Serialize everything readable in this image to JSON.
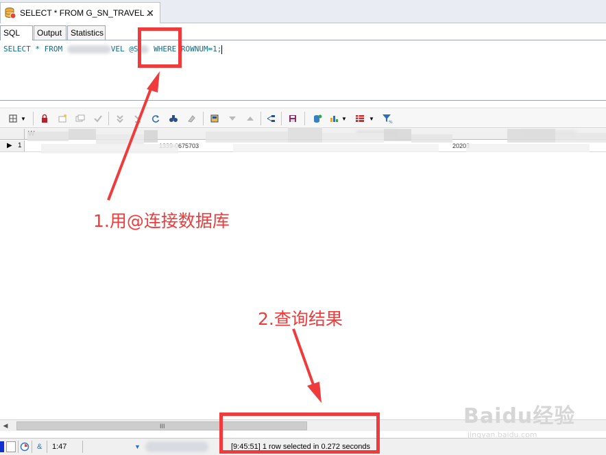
{
  "window": {
    "tab_title": "SELECT * FROM G_SN_TRAVEL ...",
    "close_glyph": "✕"
  },
  "subtabs": [
    {
      "label": "SQL",
      "active": true
    },
    {
      "label": "Output",
      "active": false
    },
    {
      "label": "Statistics",
      "active": false
    }
  ],
  "editor": {
    "sql_part1": "SELECT * FROM ",
    "sql_part2": "VEL",
    "sql_part3": "@S",
    "sql_part4": " WHERE ROWNUM=1;"
  },
  "toolbar": {
    "icons": [
      "grid-options-icon",
      "dropdown-icon",
      "lock-icon",
      "insert-record-icon",
      "copy-record-icon",
      "post-edit-icon",
      "first-record-icon",
      "last-record-icon",
      "refresh-icon",
      "find-icon",
      "clear-icon",
      "save-layout-icon",
      "sort-desc-icon",
      "sort-asc-icon",
      "export-tree-icon",
      "save-icon",
      "query-db-icon",
      "chart-icon",
      "dropdown-icon",
      "table-icon",
      "dropdown-icon",
      "filter-icon"
    ]
  },
  "grid": {
    "column_header": "W",
    "row_number": "1",
    "row_marker": "▶",
    "visible_value": "1339-0675703",
    "visible_value2": "20203"
  },
  "scrollbar": {
    "left_arrow": "◀",
    "grip": "III"
  },
  "status": {
    "position": "1:47",
    "amp": "&",
    "message": "[9:45:51]  1 row selected in 0.272 seconds"
  },
  "annotations": {
    "label1": "1.用@连接数据库",
    "label2": "2.查询结果"
  },
  "watermark": {
    "logo": "Baidu经验",
    "url": "jingyan.baidu.com"
  },
  "colors": {
    "annotation_red": "#ef3b3b",
    "sql_keyword": "#0a6a8a"
  }
}
